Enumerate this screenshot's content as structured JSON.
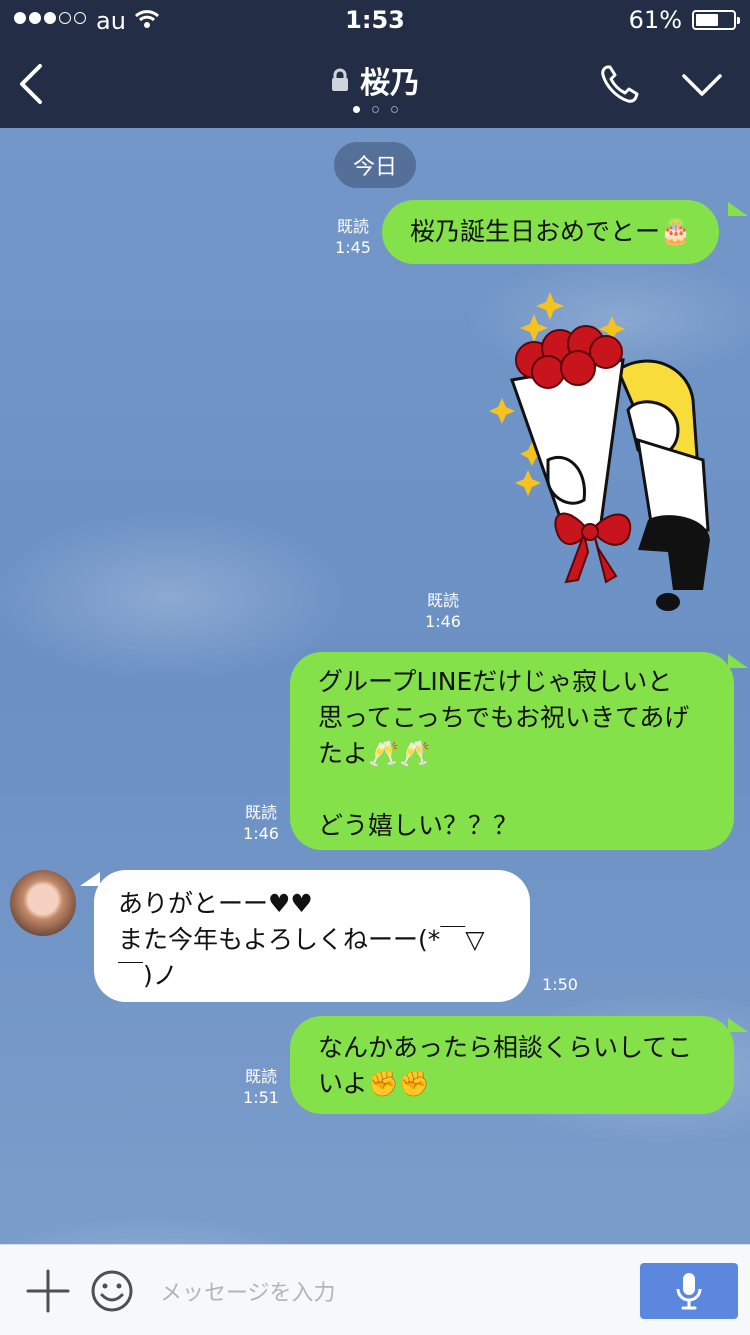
{
  "status_bar": {
    "carrier": "au",
    "time": "1:53",
    "battery_text": "61%",
    "battery_level": 0.61,
    "signal_bars": 3,
    "signal_total": 5
  },
  "header": {
    "title": "桜乃",
    "page_count": 3,
    "active_page": 1
  },
  "date_label": "今日",
  "messages": [
    {
      "sender": "me",
      "text": "桜乃誕生日おめでとー🎂",
      "read": "既読",
      "time": "1:45"
    },
    {
      "sender": "me",
      "type": "sticker",
      "read": "既読",
      "time": "1:46"
    },
    {
      "sender": "me",
      "text": "グループLINEだけじゃ寂しいと\n思ってこっちでもお祝いきてあげ\nたよ🥂🥂\n\nどう嬉しい？？？",
      "read": "既読",
      "time": "1:46"
    },
    {
      "sender": "them",
      "text": "ありがとーー♥♥\nまた今年もよろしくねーー(*￣▽\n￣)ノ",
      "time": "1:50"
    },
    {
      "sender": "me",
      "text": "なんかあったら相談くらいしてこ\nいよ✊✊",
      "read": "既読",
      "time": "1:51"
    }
  ],
  "input": {
    "placeholder": "メッセージを入力"
  },
  "icons": {
    "back": "chevron-left-icon",
    "lock": "lock-icon",
    "call": "phone-icon",
    "menu": "chevron-down-icon",
    "plus": "plus-icon",
    "emoji": "smiley-icon",
    "mic": "microphone-icon"
  },
  "colors": {
    "header_bg": "#232d45",
    "my_bubble": "#84e14a",
    "their_bubble": "#ffffff",
    "mic_button": "#5b87de",
    "chat_bg": "#6f95c8"
  }
}
